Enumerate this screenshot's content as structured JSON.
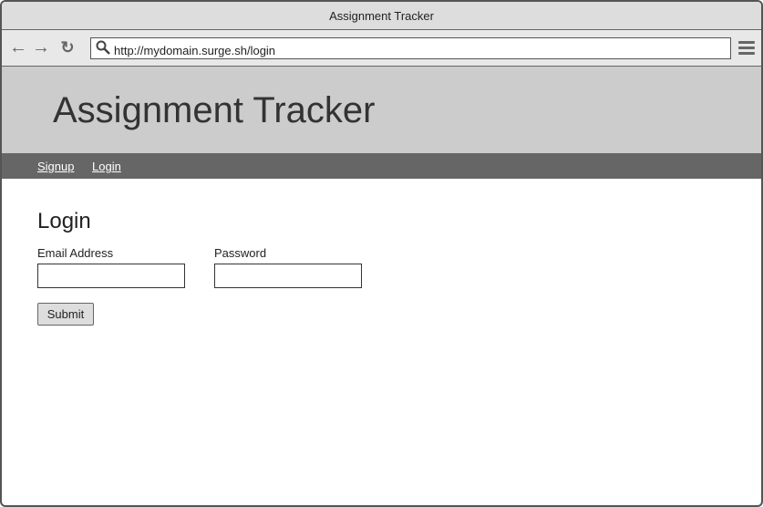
{
  "window": {
    "title": "Assignment Tracker"
  },
  "toolbar": {
    "url": "http://mydomain.surge.sh/login",
    "icons": [
      "back-arrow-icon",
      "forward-arrow-icon",
      "reload-icon",
      "search-icon",
      "hamburger-menu-icon"
    ]
  },
  "header": {
    "title": "Assignment Tracker"
  },
  "nav": {
    "items": [
      {
        "label": "Signup"
      },
      {
        "label": "Login"
      }
    ]
  },
  "form": {
    "heading": "Login",
    "email_label": "Email Address",
    "email_value": "",
    "password_label": "Password",
    "password_value": "",
    "submit_label": "Submit"
  }
}
